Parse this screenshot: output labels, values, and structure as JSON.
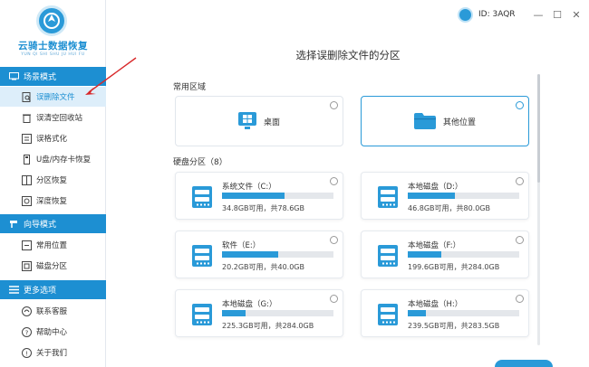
{
  "app": {
    "name": "云骑士数据恢复",
    "pinyin": "YUN QI SHI SHU JU HUI FU"
  },
  "topbar": {
    "user_id": "ID: 3AQR",
    "minimize": "—",
    "maximize": "☐",
    "close": "✕"
  },
  "sidebar": {
    "sections": [
      {
        "title": "场景模式",
        "items": [
          {
            "label": "误删除文件",
            "icon": "file-search-icon",
            "active": true
          },
          {
            "label": "误清空回收站",
            "icon": "recycle-bin-icon"
          },
          {
            "label": "误格式化",
            "icon": "format-icon"
          },
          {
            "label": "U盘/内存卡恢复",
            "icon": "usb-icon"
          },
          {
            "label": "分区恢复",
            "icon": "partition-icon"
          },
          {
            "label": "深度恢复",
            "icon": "deep-scan-icon"
          }
        ]
      },
      {
        "title": "向导模式",
        "items": [
          {
            "label": "常用位置",
            "icon": "location-icon"
          },
          {
            "label": "磁盘分区",
            "icon": "disk-icon"
          }
        ]
      },
      {
        "title": "更多选项",
        "items": [
          {
            "label": "联系客服",
            "icon": "headset-icon"
          },
          {
            "label": "帮助中心",
            "icon": "help-icon"
          },
          {
            "label": "关于我们",
            "icon": "info-icon"
          }
        ]
      }
    ]
  },
  "main": {
    "title": "选择误删除文件的分区",
    "common_label": "常用区域",
    "common_items": [
      {
        "label": "桌面",
        "icon": "desktop-windows-icon",
        "selected": false
      },
      {
        "label": "其他位置",
        "icon": "folder-icon",
        "selected": true
      }
    ],
    "disk_label": "硬盘分区（8）",
    "disks": [
      {
        "name": "系统文件（C:）",
        "usage": "34.8GB可用，共78.6GB",
        "used_fraction": 0.56
      },
      {
        "name": "本地磁盘（D:）",
        "usage": "46.8GB可用，共80.0GB",
        "used_fraction": 0.42
      },
      {
        "name": "软件（E:）",
        "usage": "20.2GB可用，共40.0GB",
        "used_fraction": 0.5
      },
      {
        "name": "本地磁盘（F:）",
        "usage": "199.6GB可用，共284.0GB",
        "used_fraction": 0.3
      },
      {
        "name": "本地磁盘（G:）",
        "usage": "225.3GB可用，共284.0GB",
        "used_fraction": 0.21
      },
      {
        "name": "本地磁盘（H:）",
        "usage": "239.5GB可用，共283.5GB",
        "used_fraction": 0.16
      }
    ]
  },
  "colors": {
    "accent": "#1d8fd2",
    "bar_fill": "#2a9ad8",
    "bar_track": "#e4e7eb"
  }
}
